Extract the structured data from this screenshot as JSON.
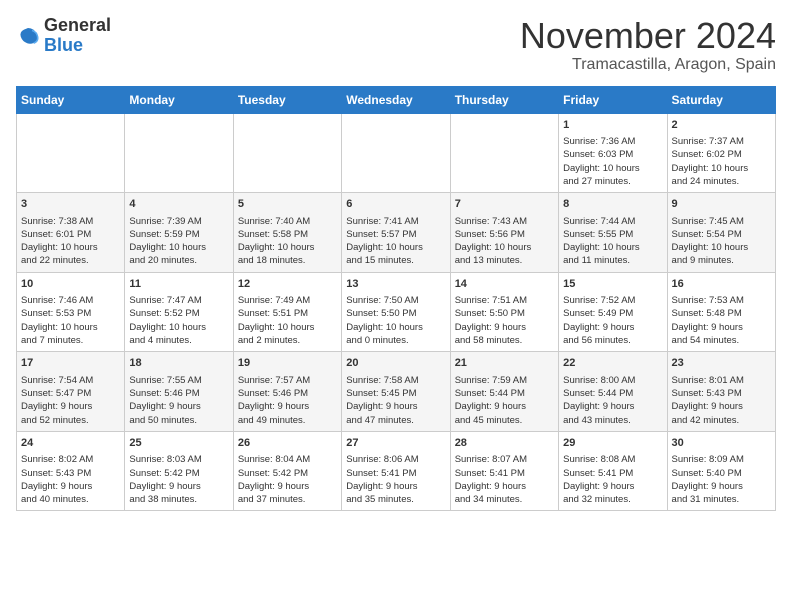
{
  "logo": {
    "general": "General",
    "blue": "Blue"
  },
  "header": {
    "month": "November 2024",
    "location": "Tramacastilla, Aragon, Spain"
  },
  "weekdays": [
    "Sunday",
    "Monday",
    "Tuesday",
    "Wednesday",
    "Thursday",
    "Friday",
    "Saturday"
  ],
  "weeks": [
    [
      {
        "day": "",
        "info": ""
      },
      {
        "day": "",
        "info": ""
      },
      {
        "day": "",
        "info": ""
      },
      {
        "day": "",
        "info": ""
      },
      {
        "day": "",
        "info": ""
      },
      {
        "day": "1",
        "info": "Sunrise: 7:36 AM\nSunset: 6:03 PM\nDaylight: 10 hours\nand 27 minutes."
      },
      {
        "day": "2",
        "info": "Sunrise: 7:37 AM\nSunset: 6:02 PM\nDaylight: 10 hours\nand 24 minutes."
      }
    ],
    [
      {
        "day": "3",
        "info": "Sunrise: 7:38 AM\nSunset: 6:01 PM\nDaylight: 10 hours\nand 22 minutes."
      },
      {
        "day": "4",
        "info": "Sunrise: 7:39 AM\nSunset: 5:59 PM\nDaylight: 10 hours\nand 20 minutes."
      },
      {
        "day": "5",
        "info": "Sunrise: 7:40 AM\nSunset: 5:58 PM\nDaylight: 10 hours\nand 18 minutes."
      },
      {
        "day": "6",
        "info": "Sunrise: 7:41 AM\nSunset: 5:57 PM\nDaylight: 10 hours\nand 15 minutes."
      },
      {
        "day": "7",
        "info": "Sunrise: 7:43 AM\nSunset: 5:56 PM\nDaylight: 10 hours\nand 13 minutes."
      },
      {
        "day": "8",
        "info": "Sunrise: 7:44 AM\nSunset: 5:55 PM\nDaylight: 10 hours\nand 11 minutes."
      },
      {
        "day": "9",
        "info": "Sunrise: 7:45 AM\nSunset: 5:54 PM\nDaylight: 10 hours\nand 9 minutes."
      }
    ],
    [
      {
        "day": "10",
        "info": "Sunrise: 7:46 AM\nSunset: 5:53 PM\nDaylight: 10 hours\nand 7 minutes."
      },
      {
        "day": "11",
        "info": "Sunrise: 7:47 AM\nSunset: 5:52 PM\nDaylight: 10 hours\nand 4 minutes."
      },
      {
        "day": "12",
        "info": "Sunrise: 7:49 AM\nSunset: 5:51 PM\nDaylight: 10 hours\nand 2 minutes."
      },
      {
        "day": "13",
        "info": "Sunrise: 7:50 AM\nSunset: 5:50 PM\nDaylight: 10 hours\nand 0 minutes."
      },
      {
        "day": "14",
        "info": "Sunrise: 7:51 AM\nSunset: 5:50 PM\nDaylight: 9 hours\nand 58 minutes."
      },
      {
        "day": "15",
        "info": "Sunrise: 7:52 AM\nSunset: 5:49 PM\nDaylight: 9 hours\nand 56 minutes."
      },
      {
        "day": "16",
        "info": "Sunrise: 7:53 AM\nSunset: 5:48 PM\nDaylight: 9 hours\nand 54 minutes."
      }
    ],
    [
      {
        "day": "17",
        "info": "Sunrise: 7:54 AM\nSunset: 5:47 PM\nDaylight: 9 hours\nand 52 minutes."
      },
      {
        "day": "18",
        "info": "Sunrise: 7:55 AM\nSunset: 5:46 PM\nDaylight: 9 hours\nand 50 minutes."
      },
      {
        "day": "19",
        "info": "Sunrise: 7:57 AM\nSunset: 5:46 PM\nDaylight: 9 hours\nand 49 minutes."
      },
      {
        "day": "20",
        "info": "Sunrise: 7:58 AM\nSunset: 5:45 PM\nDaylight: 9 hours\nand 47 minutes."
      },
      {
        "day": "21",
        "info": "Sunrise: 7:59 AM\nSunset: 5:44 PM\nDaylight: 9 hours\nand 45 minutes."
      },
      {
        "day": "22",
        "info": "Sunrise: 8:00 AM\nSunset: 5:44 PM\nDaylight: 9 hours\nand 43 minutes."
      },
      {
        "day": "23",
        "info": "Sunrise: 8:01 AM\nSunset: 5:43 PM\nDaylight: 9 hours\nand 42 minutes."
      }
    ],
    [
      {
        "day": "24",
        "info": "Sunrise: 8:02 AM\nSunset: 5:43 PM\nDaylight: 9 hours\nand 40 minutes."
      },
      {
        "day": "25",
        "info": "Sunrise: 8:03 AM\nSunset: 5:42 PM\nDaylight: 9 hours\nand 38 minutes."
      },
      {
        "day": "26",
        "info": "Sunrise: 8:04 AM\nSunset: 5:42 PM\nDaylight: 9 hours\nand 37 minutes."
      },
      {
        "day": "27",
        "info": "Sunrise: 8:06 AM\nSunset: 5:41 PM\nDaylight: 9 hours\nand 35 minutes."
      },
      {
        "day": "28",
        "info": "Sunrise: 8:07 AM\nSunset: 5:41 PM\nDaylight: 9 hours\nand 34 minutes."
      },
      {
        "day": "29",
        "info": "Sunrise: 8:08 AM\nSunset: 5:41 PM\nDaylight: 9 hours\nand 32 minutes."
      },
      {
        "day": "30",
        "info": "Sunrise: 8:09 AM\nSunset: 5:40 PM\nDaylight: 9 hours\nand 31 minutes."
      }
    ]
  ]
}
